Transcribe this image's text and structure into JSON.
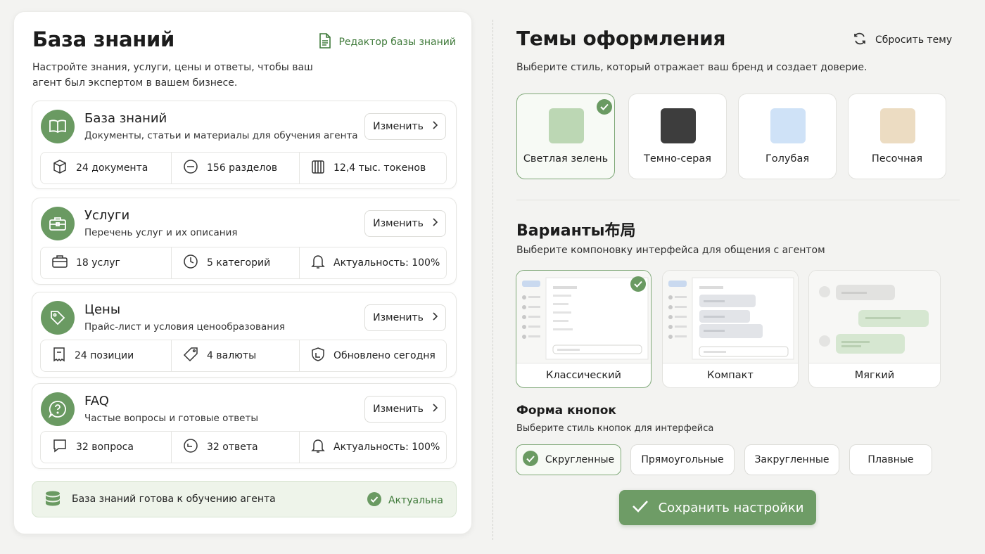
{
  "knowledge_base": {
    "title": "База знаний",
    "editor_link": "Редактор базы знаний",
    "subtitle": "Настройте знания, услуги, цены и ответы, чтобы ваш агент был экспертом в вашем бизнесе.",
    "edit_label": "Изменить",
    "sections": [
      {
        "title": "База знаний",
        "description": "Документы, статьи и материалы для обучения агента",
        "icon": "book-icon",
        "stats": [
          {
            "icon": "box-icon",
            "text": "24 документа"
          },
          {
            "icon": "minus-circle-icon",
            "text": "156 разделов"
          },
          {
            "icon": "columns-icon",
            "text": "12,4 тыс. токенов"
          }
        ]
      },
      {
        "title": "Услуги",
        "description": "Перечень услуг и их описания",
        "icon": "briefcase-icon",
        "stats": [
          {
            "icon": "briefcase-icon",
            "text": "18 услуг"
          },
          {
            "icon": "clock-icon",
            "text": "5 категорий"
          },
          {
            "icon": "bell-icon",
            "text": "Актуальность: 100%"
          }
        ]
      },
      {
        "title": "Цены",
        "description": "Прайс-лист и условия ценообразования",
        "icon": "price-tag-icon",
        "stats": [
          {
            "icon": "receipt-icon",
            "text": "24 позиции"
          },
          {
            "icon": "tag-icon",
            "text": "4 валюты"
          },
          {
            "icon": "refresh-shield-icon",
            "text": "Обновлено сегодня"
          }
        ]
      },
      {
        "title": "FAQ",
        "description": "Частые вопросы и готовые ответы",
        "icon": "question-icon",
        "stats": [
          {
            "icon": "chat-bubble-icon",
            "text": "32 вопроса"
          },
          {
            "icon": "reply-icon",
            "text": "32 ответа"
          },
          {
            "icon": "bell-icon",
            "text": "Актуальность: 100%"
          }
        ]
      }
    ],
    "ready_banner": {
      "text": "База знаний готова к обучению агента",
      "status": "Актуальна"
    }
  },
  "themes": {
    "title": "Темы оформления",
    "reset_label": "Сбросить тему",
    "subtitle": "Выберите стиль, который отражает ваш бренд и создает доверие.",
    "options": [
      {
        "label": "Светлая зелень",
        "color": "#bcd7b4",
        "selected": true
      },
      {
        "label": "Темно-серая",
        "color": "#3d3d3d",
        "selected": false
      },
      {
        "label": "Голубая",
        "color": "#cfe2f7",
        "selected": false
      },
      {
        "label": "Песочная",
        "color": "#ecdcc2",
        "selected": false
      }
    ]
  },
  "layouts": {
    "title": "Варианты布局",
    "subtitle": "Выберите компоновку интерфейса для общения с агентом",
    "options": [
      {
        "label": "Классический",
        "selected": true
      },
      {
        "label": "Компакт",
        "selected": false
      },
      {
        "label": "Мягкий",
        "selected": false
      }
    ]
  },
  "button_shape": {
    "title": "Форма кнопок",
    "subtitle": "Выберите стиль кнопок для интерфейса",
    "options": [
      {
        "label": "Скругленные",
        "selected": true
      },
      {
        "label": "Прямоугольные",
        "selected": false
      },
      {
        "label": "Закругленные",
        "selected": false
      },
      {
        "label": "Плавные",
        "selected": false
      }
    ]
  },
  "save_label": "Сохранить настройки",
  "colors": {
    "accent": "#6a9a62",
    "accent_text": "#3f7a3a",
    "selected_border": "#7fa878",
    "banner_bg": "#eef4ea"
  }
}
